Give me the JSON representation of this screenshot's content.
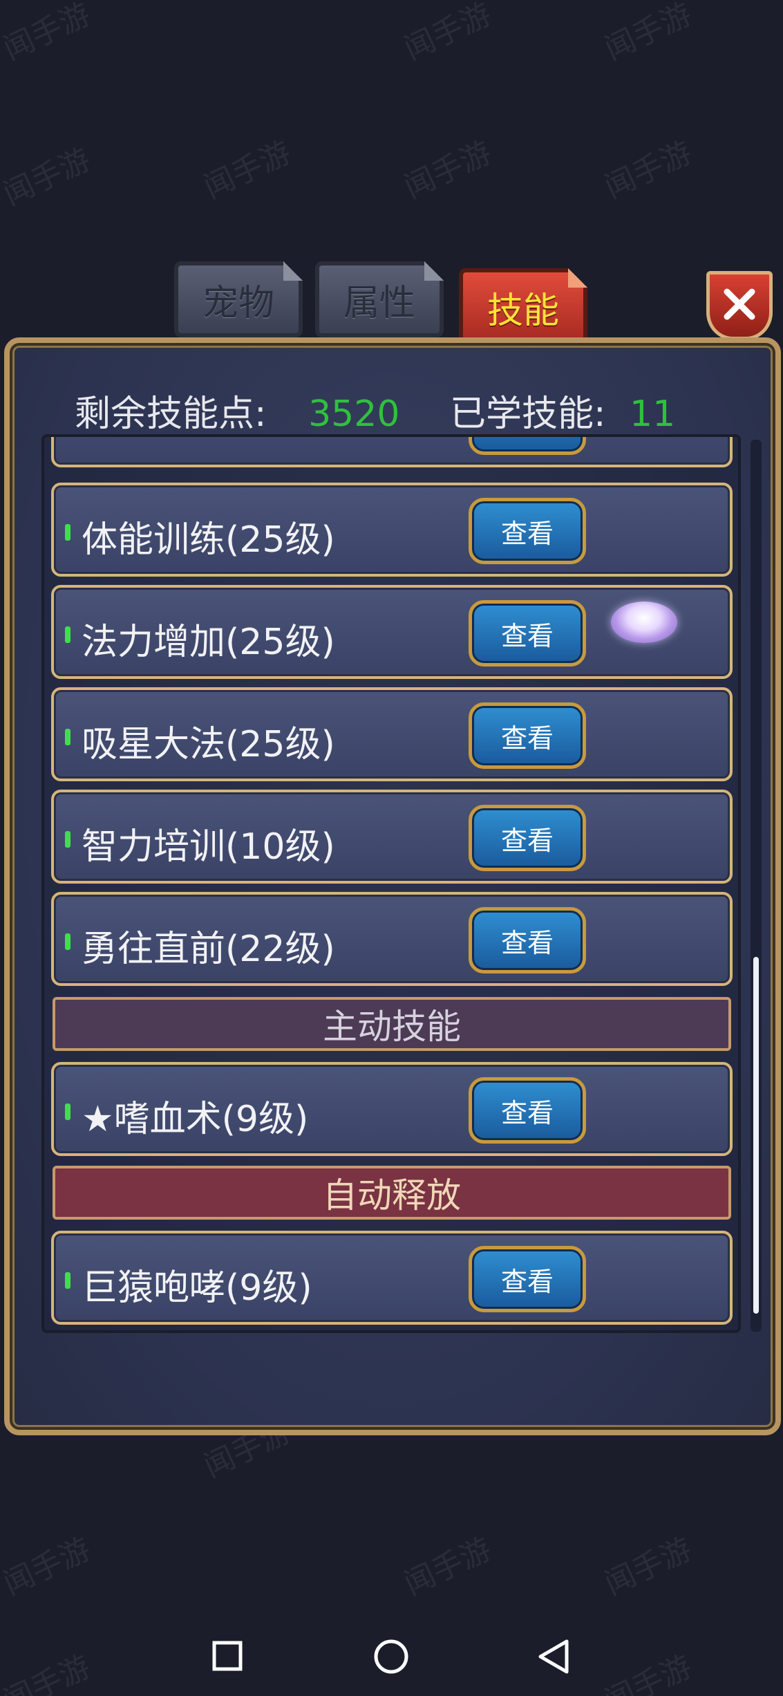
{
  "tabs": {
    "pet": "宠物",
    "attributes": "属性",
    "skills": "技能"
  },
  "stats": {
    "remaining_label": "剩余技能点:",
    "remaining_value": "3520",
    "learned_label": "已学技能:",
    "learned_value": "11"
  },
  "view_label": "查看",
  "skills_passive": [
    {
      "name": "体能训练(25级)"
    },
    {
      "name": "法力增加(25级)"
    },
    {
      "name": "吸星大法(25级)"
    },
    {
      "name": "智力培训(10级)"
    },
    {
      "name": "勇往直前(22级)"
    }
  ],
  "section_active": "主动技能",
  "skills_active": [
    {
      "name": "★嗜血术(9级)"
    }
  ],
  "section_auto": "自动释放",
  "skills_auto": [
    {
      "name": "巨猿咆哮(9级)"
    }
  ],
  "watermark": "闻手游",
  "colors": {
    "accent_green": "#2fc13c",
    "active_tab": "#c2362a",
    "view_button": "#2478bd"
  },
  "icons": {
    "close": "close-icon",
    "gem": "gem-icon",
    "nav_recent": "square-icon",
    "nav_home": "circle-icon",
    "nav_back": "triangle-back-icon"
  }
}
